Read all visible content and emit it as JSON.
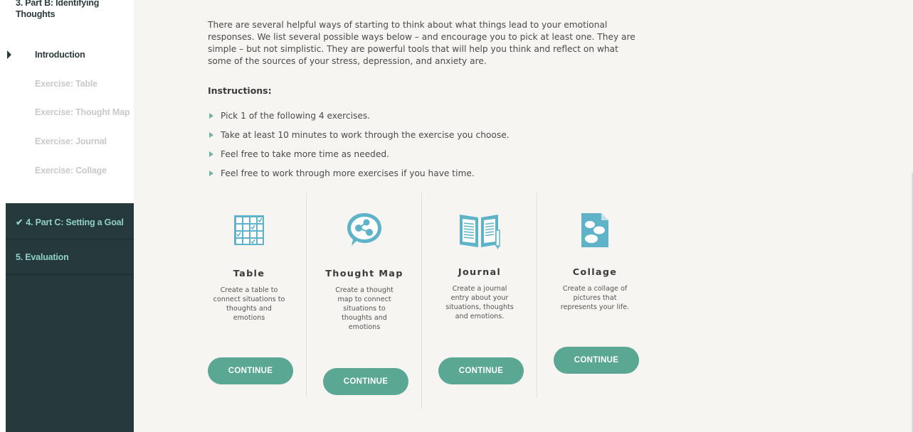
{
  "sidebar": {
    "section_title": "3. Part B: Identifying Thoughts",
    "items": [
      {
        "label": "Introduction"
      },
      {
        "label": "Exercise: Table"
      },
      {
        "label": "Exercise: Thought Map"
      },
      {
        "label": "Exercise: Journal"
      },
      {
        "label": "Exercise: Collage"
      }
    ],
    "dark_items": [
      {
        "check": "✔",
        "label": "4. Part C: Setting a Goal"
      },
      {
        "label": "5. Evaluation"
      }
    ]
  },
  "main": {
    "intro": "There are several helpful ways of starting to think about what things lead to your emotional responses. We list several possible ways below – and encourage you to pick at least one. They are simple – but not simplistic. They are powerful tools that will help you think and reflect on what some of the sources of your stress, depression, and anxiety are.",
    "instructions_heading": "Instructions:",
    "bullets": [
      "Pick 1 of the following 4 exercises.",
      "Take at least 10 minutes to work through the exercise you choose.",
      "Feel free to take more time as needed.",
      "Feel free to work through more exercises if you have time."
    ],
    "cards": [
      {
        "title": "Table",
        "desc": "Create a table to connect situations to thoughts and emotions",
        "button": "CONTINUE",
        "icon": "table-icon"
      },
      {
        "title": "Thought Map",
        "desc": "Create a thought map to connect situations to thoughts and emotions",
        "button": "CONTINUE",
        "icon": "thought-map-icon"
      },
      {
        "title": "Journal",
        "desc": "Create a journal entry about your situations, thoughts and emotions.",
        "button": "CONTINUE",
        "icon": "journal-icon"
      },
      {
        "title": "Collage",
        "desc": "Create a collage of pictures that represents your life.",
        "button": "CONTINUE",
        "icon": "collage-icon"
      }
    ]
  },
  "colors": {
    "accent": "#5aa793",
    "icon": "#5fb3c9",
    "sidebar_dark": "#25393d",
    "sidebar_dark_text": "#8fd0bf"
  }
}
